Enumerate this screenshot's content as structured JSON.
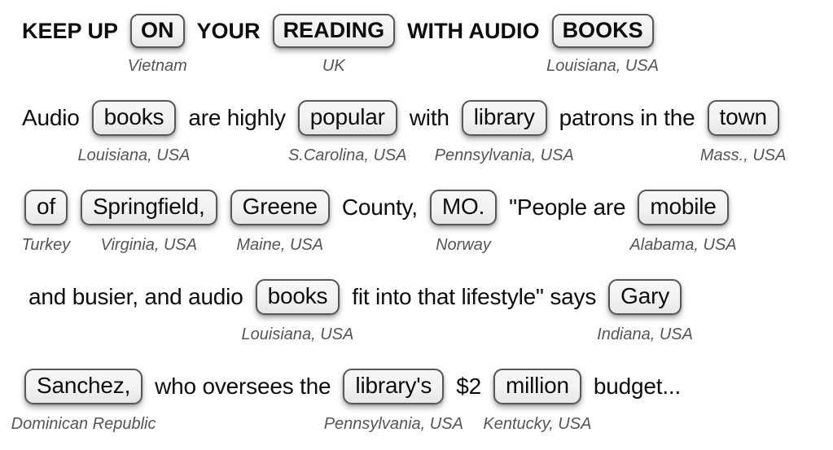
{
  "document": {
    "background_color": "#ffffff",
    "text_color": "#0d0d0d",
    "caption_color": "#555555",
    "box_border_color": "#575757",
    "box_fill_color": "#f2f2f2"
  },
  "lines": [
    {
      "id": "line-1",
      "style": "headline",
      "tokens": [
        {
          "text": "KEEP UP",
          "boxed": false,
          "caption": ""
        },
        {
          "text": "ON",
          "boxed": true,
          "caption": "Vietnam"
        },
        {
          "text": "YOUR",
          "boxed": false,
          "caption": ""
        },
        {
          "text": "READING",
          "boxed": true,
          "caption": "UK"
        },
        {
          "text": "WITH AUDIO",
          "boxed": false,
          "caption": ""
        },
        {
          "text": "BOOKS",
          "boxed": true,
          "caption": "Louisiana, USA"
        }
      ]
    },
    {
      "id": "line-2",
      "style": "body",
      "tokens": [
        {
          "text": "Audio",
          "boxed": false,
          "caption": ""
        },
        {
          "text": "books",
          "boxed": true,
          "caption": "Louisiana, USA"
        },
        {
          "text": "are highly",
          "boxed": false,
          "caption": ""
        },
        {
          "text": "popular",
          "boxed": true,
          "caption": "S.Carolina, USA"
        },
        {
          "text": "with",
          "boxed": false,
          "caption": ""
        },
        {
          "text": "library",
          "boxed": true,
          "caption": "Pennsylvania, USA"
        },
        {
          "text": "patrons in the",
          "boxed": false,
          "caption": ""
        },
        {
          "text": "town",
          "boxed": true,
          "caption": "Mass., USA"
        }
      ]
    },
    {
      "id": "line-3",
      "style": "body",
      "tokens": [
        {
          "text": "of",
          "boxed": true,
          "caption": "Turkey"
        },
        {
          "text": "Springfield,",
          "boxed": true,
          "caption": "Virginia, USA"
        },
        {
          "text": "Greene",
          "boxed": true,
          "caption": "Maine, USA"
        },
        {
          "text": "County,",
          "boxed": false,
          "caption": ""
        },
        {
          "text": "MO.",
          "boxed": true,
          "caption": "Norway"
        },
        {
          "text": "\"People are",
          "boxed": false,
          "caption": ""
        },
        {
          "text": "mobile",
          "boxed": true,
          "caption": "Alabama, USA"
        }
      ]
    },
    {
      "id": "line-4",
      "style": "body",
      "tokens": [
        {
          "text": "and busier, and audio",
          "boxed": false,
          "caption": ""
        },
        {
          "text": "books",
          "boxed": true,
          "caption": "Louisiana, USA"
        },
        {
          "text": "fit into that lifestyle\" says",
          "boxed": false,
          "caption": ""
        },
        {
          "text": "Gary",
          "boxed": true,
          "caption": "Indiana, USA"
        }
      ]
    },
    {
      "id": "line-5",
      "style": "body",
      "tokens": [
        {
          "text": "Sanchez,",
          "boxed": true,
          "caption": "Dominican Republic"
        },
        {
          "text": "who oversees the",
          "boxed": false,
          "caption": ""
        },
        {
          "text": "library's",
          "boxed": true,
          "caption": "Pennsylvania, USA"
        },
        {
          "text": "$2",
          "boxed": false,
          "caption": ""
        },
        {
          "text": "million",
          "boxed": true,
          "caption": "Kentucky, USA"
        },
        {
          "text": "budget...",
          "boxed": false,
          "caption": ""
        }
      ]
    }
  ]
}
